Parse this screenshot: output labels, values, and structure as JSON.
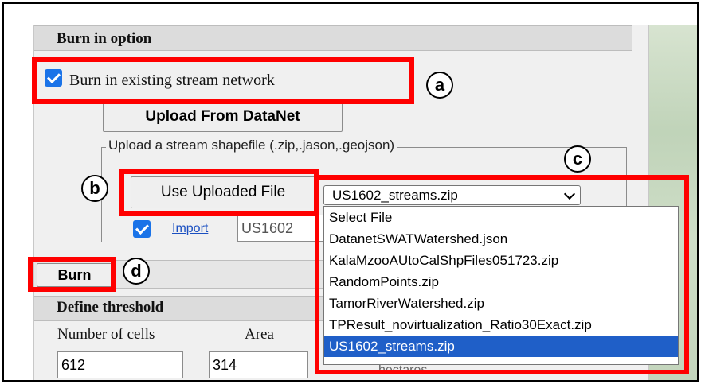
{
  "burn_section": {
    "title": "Burn in option",
    "burn_existing_label": "Burn in existing stream network",
    "upload_datanet_label": "Upload From DataNet",
    "upload_legend": "Upload a stream shapefile (.zip,.jason,.geojson)",
    "use_uploaded_label": "Use Uploaded File",
    "selected_file": "US1602_streams.zip",
    "import_link": "Import",
    "import_value": "US1602",
    "burn_button": "Burn",
    "file_options": [
      "Select File",
      "DatanetSWATWatershed.json",
      "KalaMzooAUtoCalShpFiles051723.zip",
      "RandomPoints.zip",
      "TamorRiverWatershed.zip",
      "TPResult_novirtualization_Ratio30Exact.zip",
      "US1602_streams.zip"
    ]
  },
  "threshold_section": {
    "title": "Define threshold",
    "cells_label": "Number of cells",
    "area_label": "Area",
    "cells_value": "612",
    "area_value": "314",
    "area_unit": "hectares"
  },
  "callouts": {
    "a": "a",
    "b": "b",
    "c": "c",
    "d": "d"
  },
  "colors": {
    "highlight": "#ff0000",
    "selection": "#1f5fc8",
    "checkbox": "#1a73e8"
  }
}
